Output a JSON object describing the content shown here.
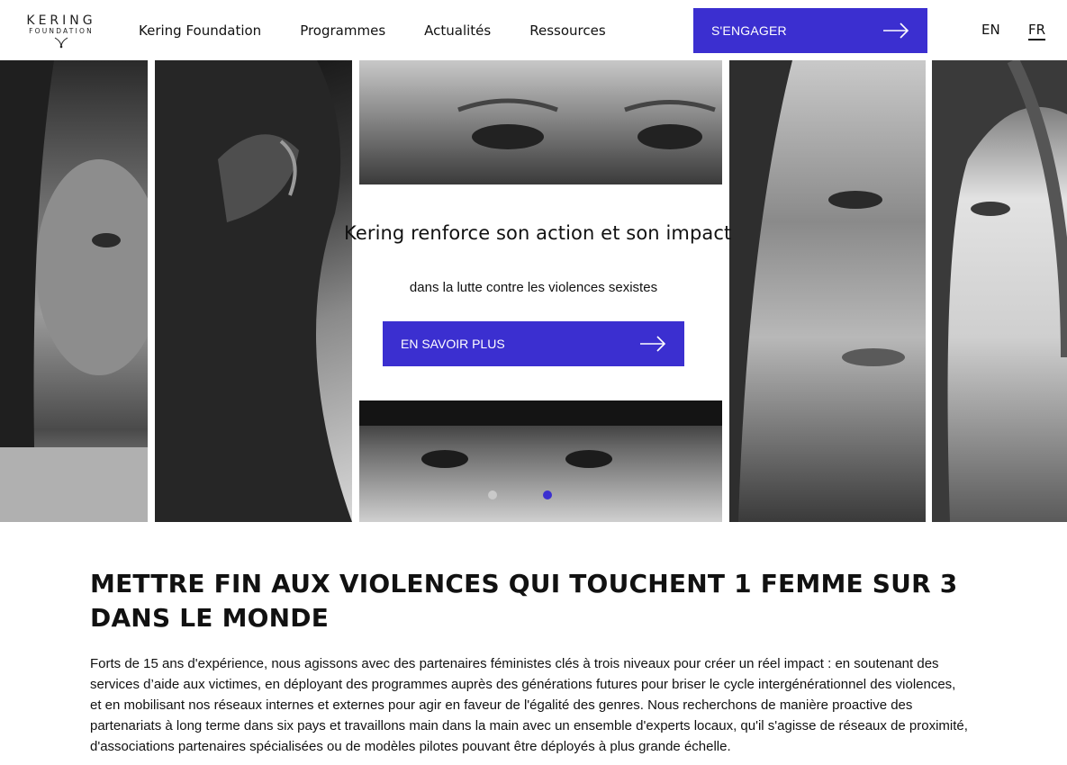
{
  "header": {
    "logo_line1": "KERING",
    "logo_line2": "FOUNDATION",
    "nav": [
      "Kering Foundation",
      "Programmes",
      "Actualités",
      "Ressources"
    ],
    "cta_label": "S'ENGAGER",
    "lang_en": "EN",
    "lang_fr": "FR"
  },
  "hero": {
    "title": "Kering renforce son action et son impact",
    "subtitle": "dans la lutte contre les violences sexistes",
    "button_label": "EN SAVOIR PLUS",
    "slides_count": 2,
    "active_slide": 2
  },
  "section": {
    "heading": "METTRE FIN AUX VIOLENCES QUI TOUCHENT 1 FEMME SUR 3 DANS LE MONDE",
    "body": "Forts de 15 ans d'expérience, nous agissons avec des partenaires féministes clés à trois niveaux pour créer un réel impact : en soutenant des services d’aide aux victimes, en déployant des programmes auprès des générations futures pour briser le cycle intergénérationnel des violences, et en mobilisant nos réseaux internes et externes pour agir en faveur de l'égalité des genres. Nous recherchons de manière proactive des partenariats à long terme dans six pays et travaillons main dans la main avec un ensemble d'experts locaux, qu'il s'agisse de réseaux de proximité, d'associations partenaires spécialisées ou de modèles pilotes pouvant être déployés à plus grande échelle."
  },
  "colors": {
    "accent": "#3b2fd0",
    "text": "#111111",
    "background": "#ffffff"
  }
}
